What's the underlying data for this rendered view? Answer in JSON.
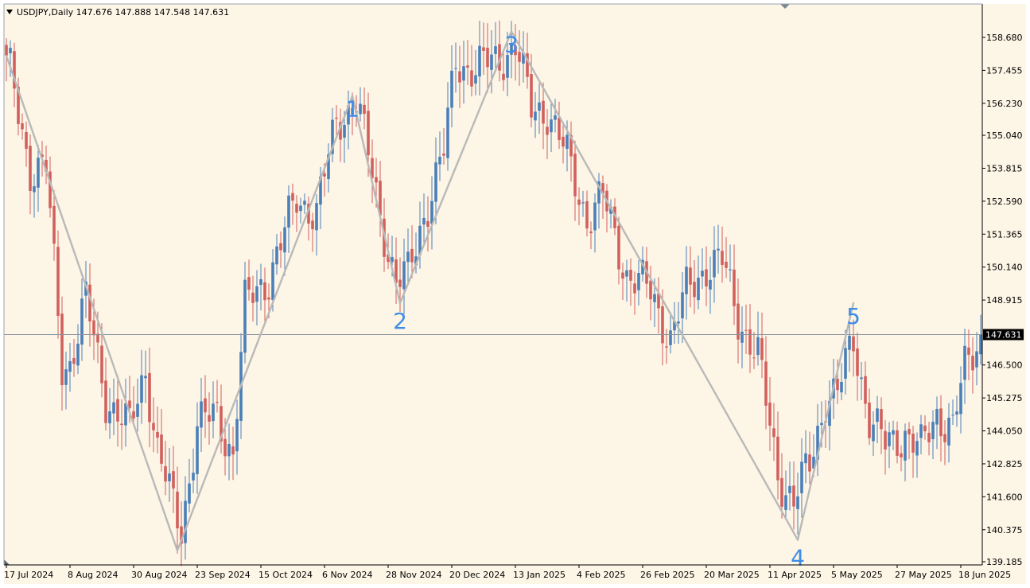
{
  "chart_data": {
    "type": "candlestick",
    "symbol": "USDJPY",
    "timeframe": "Daily",
    "header_text": "USDJPY,Daily  147.676 147.888 147.548 147.631",
    "ohlc_header": {
      "open": 147.676,
      "high": 147.888,
      "low": 147.548,
      "close": 147.631
    },
    "current_price": 147.631,
    "current_price_label": "147.631",
    "ylim": [
      139.0,
      159.5
    ],
    "y_ticks": [
      "158.680",
      "157.455",
      "156.230",
      "155.040",
      "153.815",
      "152.590",
      "151.365",
      "150.140",
      "148.915",
      "147.690",
      "146.500",
      "145.275",
      "144.050",
      "142.825",
      "141.600",
      "140.375",
      "139.185"
    ],
    "x_ticks": [
      "17 Jul 2024",
      "8 Aug 2024",
      "30 Aug 2024",
      "23 Sep 2024",
      "15 Oct 2024",
      "6 Nov 2024",
      "28 Nov 2024",
      "20 Dec 2024",
      "13 Jan 2025",
      "4 Feb 2025",
      "26 Feb 2025",
      "20 Mar 2025",
      "11 Apr 2025",
      "5 May 2025",
      "27 May 2025",
      "18 Jun 2025"
    ],
    "x_tick_bars": [
      0,
      16,
      32,
      48,
      64,
      80,
      96,
      112,
      128,
      144,
      160,
      176,
      192,
      208,
      224,
      240
    ],
    "bar_count": 246,
    "wave_points": [
      {
        "label": "",
        "bar": 0,
        "price": 158.0
      },
      {
        "label": "",
        "bar": 43,
        "price": 139.6
      },
      {
        "label": "1",
        "bar": 87,
        "price": 156.5
      },
      {
        "label": "2",
        "bar": 99,
        "price": 148.8
      },
      {
        "label": "3",
        "bar": 127,
        "price": 158.9
      },
      {
        "label": "4",
        "bar": 199,
        "price": 140.0
      },
      {
        "label": "5",
        "bar": 213,
        "price": 148.8
      }
    ],
    "colors": {
      "background": "#fdf5e6",
      "bull": "#4a7fb8",
      "bear": "#d1605d",
      "wave_line": "#b9b9b9",
      "wave_label": "#3d8ce8",
      "price_line": "#8a94a0",
      "price_tag_bg": "#000000"
    },
    "bar_anchors": [
      [
        0,
        158.0
      ],
      [
        6,
        153.8
      ],
      [
        10,
        153.8
      ],
      [
        14,
        146.5
      ],
      [
        16,
        146.6
      ],
      [
        20,
        148.9
      ],
      [
        25,
        145.3
      ],
      [
        31,
        144.1
      ],
      [
        35,
        146.4
      ],
      [
        38,
        143.3
      ],
      [
        42,
        141.2
      ],
      [
        44,
        140.4
      ],
      [
        48,
        144.3
      ],
      [
        53,
        144.6
      ],
      [
        57,
        143.2
      ],
      [
        60,
        148.7
      ],
      [
        66,
        149.8
      ],
      [
        70,
        151.4
      ],
      [
        73,
        152.7
      ],
      [
        78,
        152.2
      ],
      [
        83,
        155.5
      ],
      [
        88,
        156.4
      ],
      [
        94,
        152.1
      ],
      [
        98,
        149.6
      ],
      [
        101,
        149.8
      ],
      [
        105,
        152.1
      ],
      [
        110,
        154.4
      ],
      [
        113,
        157.8
      ],
      [
        118,
        157.5
      ],
      [
        124,
        157.9
      ],
      [
        128,
        158.4
      ],
      [
        132,
        156.0
      ],
      [
        136,
        156.0
      ],
      [
        141,
        154.2
      ],
      [
        146,
        152.0
      ],
      [
        150,
        152.7
      ],
      [
        156,
        149.9
      ],
      [
        162,
        149.2
      ],
      [
        167,
        147.5
      ],
      [
        171,
        149.2
      ],
      [
        176,
        150.2
      ],
      [
        180,
        150.3
      ],
      [
        184,
        148.3
      ],
      [
        189,
        146.8
      ],
      [
        194,
        142.5
      ],
      [
        198,
        141.4
      ],
      [
        202,
        142.8
      ],
      [
        206,
        145.3
      ],
      [
        209,
        145.4
      ],
      [
        213,
        147.5
      ],
      [
        217,
        144.5
      ],
      [
        221,
        143.5
      ],
      [
        226,
        144.0
      ],
      [
        230,
        143.3
      ],
      [
        234,
        144.7
      ],
      [
        238,
        144.2
      ],
      [
        241,
        146.3
      ],
      [
        245,
        147.63
      ]
    ]
  }
}
